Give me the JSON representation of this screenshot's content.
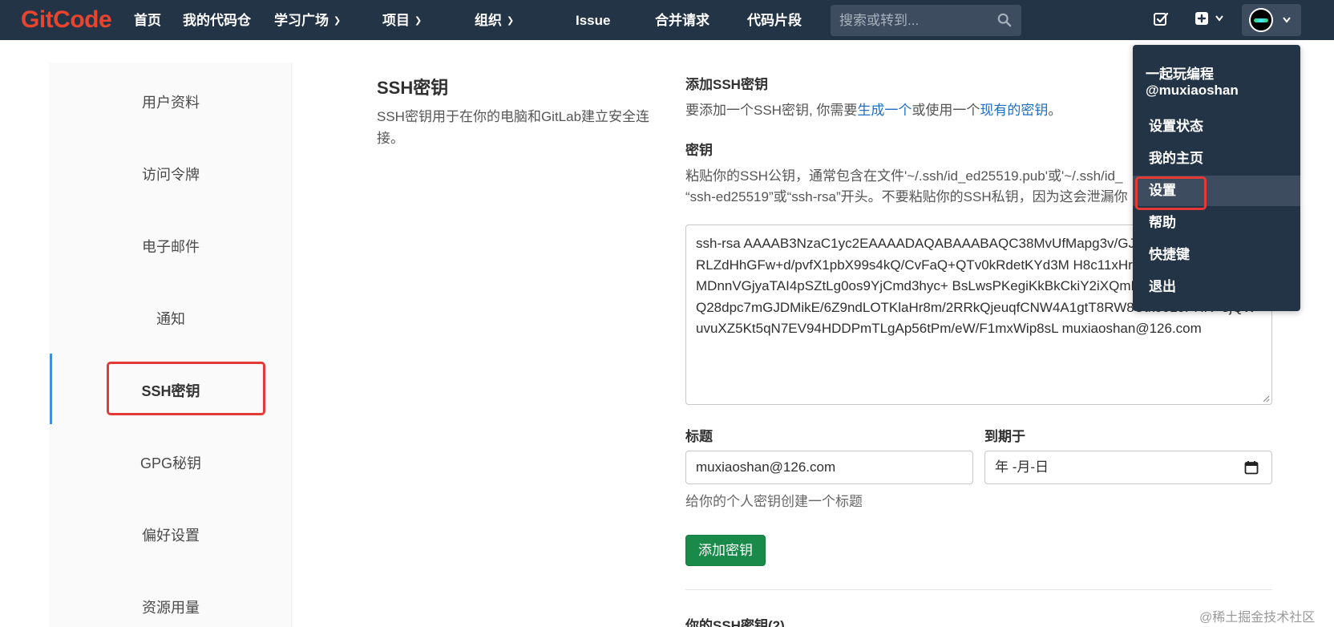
{
  "brand": {
    "logo_git": "Git",
    "logo_code": "Code"
  },
  "nav": {
    "items": [
      {
        "label": "首页",
        "has_dropdown": false
      },
      {
        "label": "我的代码仓",
        "has_dropdown": false
      },
      {
        "label": "学习广场",
        "has_dropdown": true
      },
      {
        "label": "项目",
        "has_dropdown": true
      },
      {
        "label": "组织",
        "has_dropdown": true
      },
      {
        "label": "Issue",
        "has_dropdown": false
      },
      {
        "label": "合并请求",
        "has_dropdown": false
      },
      {
        "label": "代码片段",
        "has_dropdown": false
      }
    ],
    "search_placeholder": "搜索或转到..."
  },
  "sidebar": {
    "items": [
      {
        "label": "用户资料"
      },
      {
        "label": "访问令牌"
      },
      {
        "label": "电子邮件"
      },
      {
        "label": "通知"
      },
      {
        "label": "SSH密钥",
        "active": true
      },
      {
        "label": "GPG秘钥"
      },
      {
        "label": "偏好设置"
      },
      {
        "label": "资源用量"
      }
    ]
  },
  "section": {
    "title": "SSH密钥",
    "description": "SSH密钥用于在你的电脑和GitLab建立安全连接。"
  },
  "form": {
    "add_heading": "添加SSH密钥",
    "add_text_before": "要添加一个SSH密钥, 你需要",
    "add_link_generate": "生成一个",
    "add_text_middle": "或使用一个",
    "add_link_existing": "现有的密钥",
    "add_text_after": "。",
    "key_label": "密钥",
    "key_help_line1": "粘贴你的SSH公钥，通常包含在文件'~/.ssh/id_ed25519.pub'或'~/.ssh/id_",
    "key_help_line2": "“ssh-ed25519”或“ssh-rsa”开头。不要粘贴你的SSH私钥，因为这会泄漏你",
    "key_value": "ssh-rsa AAAAB3NzaC1yc2EAAAADAQABAAABAQC38MvUfMapg3v/GJu0uZu7L u3vZJTytzfRLZdHhGFw+d/pvfX1pbX99s4kQ/CvFaQ+QTv0kRdetKYd3M H8c11xHrJQf10xlKovGsfxxTbcMDnnVGjyaTAI4pSZtLg0os9YjCmd3hyc+ BsLwsPKegiKkBkCkiY2iXQmE/tGslPoRAAyXuYhgQ28dpc7mGJDMikE/6Z9ndLOTKlaHr8m/2RRkQjeuqfCNW4A1gtT8RW8Utk0010PHR+3jQWuvuXZ5Kt5qN7EV94HDDPmTLgAp56tPm/eW/F1mxWip8sL muxiaoshan@126.com",
    "title_label": "标题",
    "title_value": "muxiaoshan@126.com",
    "expires_label": "到期于",
    "expires_placeholder": "年 -月-日",
    "title_hint": "给你的个人密钥创建一个标题",
    "submit_label": "添加密钥",
    "your_keys_label": "你的SSH密钥(2)"
  },
  "user_menu": {
    "display_name": "一起玩编程",
    "username": "@muxiaoshan",
    "items": [
      {
        "label": "设置状态"
      },
      {
        "label": "我的主页"
      },
      {
        "label": "设置",
        "highlighted": true
      },
      {
        "label": "帮助"
      },
      {
        "label": "快捷键"
      },
      {
        "label": "退出"
      }
    ]
  },
  "watermark": "@稀土掘金技术社区",
  "colors": {
    "nav_bg": "#243447",
    "logo": "#e8442e",
    "link": "#1f6fc5",
    "primary_button": "#1a8a4a",
    "highlight_box": "#e53935",
    "active_bar": "#3d8ee4"
  }
}
